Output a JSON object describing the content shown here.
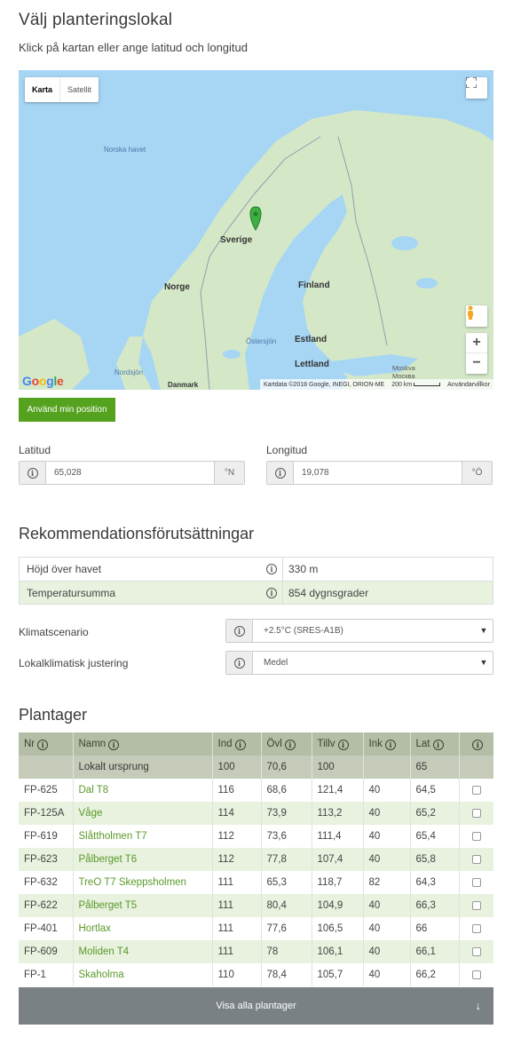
{
  "page": {
    "title": "Välj planteringslokal",
    "subtitle": "Klick på kartan eller ange latitud och longitud"
  },
  "map": {
    "type_buttons": [
      "Karta",
      "Satellit"
    ],
    "labels": {
      "sea_norway": "Norska havet",
      "sweden": "Sverige",
      "norway": "Norge",
      "finland": "Finland",
      "estonia": "Estland",
      "latvia": "Lettland",
      "baltic": "Östersjön",
      "north_sea": "Nordsjön",
      "denmark": "Danmark",
      "moscow": "Moskva\nМосква"
    },
    "google_logo": "Google",
    "attribution": "Kartdata ©2018 Google, INEGI, ORION-ME",
    "scale": "200 km",
    "terms": "Användarvillkor",
    "zoom_in": "+",
    "zoom_out": "−",
    "colors": {
      "water": "#a7d5f4",
      "land": "#cfe6c4",
      "marker": "#3cb043"
    }
  },
  "use_position_button": "Använd min position",
  "latitude": {
    "label": "Latitud",
    "value": "65,028",
    "unit": "°N"
  },
  "longitude": {
    "label": "Longitud",
    "value": "19,078",
    "unit": "°Ö"
  },
  "recommendations": {
    "title": "Rekommendationsförutsättningar",
    "rows": [
      {
        "label": "Höjd över havet",
        "value": "330 m"
      },
      {
        "label": "Temperatursumma",
        "value": "854 dygnsgrader"
      }
    ]
  },
  "climate_scenario": {
    "label": "Klimatscenario",
    "value": "+2.5°C (SRES-A1B)"
  },
  "local_adjustment": {
    "label": "Lokalklimatisk justering",
    "value": "Medel"
  },
  "plantations": {
    "title": "Plantager",
    "columns": [
      "Nr",
      "Namn",
      "Ind",
      "Övl",
      "Tillv",
      "Ink",
      "Lat"
    ],
    "local_origin": {
      "nr": "",
      "name": "Lokalt ursprung",
      "ind": "100",
      "ovl": "70,6",
      "tillv": "100",
      "ink": "",
      "lat": "65"
    },
    "rows": [
      {
        "nr": "FP-625",
        "name": "Dal T8",
        "ind": "116",
        "ovl": "68,6",
        "tillv": "121,4",
        "ink": "40",
        "lat": "64,5"
      },
      {
        "nr": "FP-125A",
        "name": "Våge",
        "ind": "114",
        "ovl": "73,9",
        "tillv": "113,2",
        "ink": "40",
        "lat": "65,2"
      },
      {
        "nr": "FP-619",
        "name": "Slåttholmen T7",
        "ind": "112",
        "ovl": "73,6",
        "tillv": "111,4",
        "ink": "40",
        "lat": "65,4"
      },
      {
        "nr": "FP-623",
        "name": "Pålberget T6",
        "ind": "112",
        "ovl": "77,8",
        "tillv": "107,4",
        "ink": "40",
        "lat": "65,8"
      },
      {
        "nr": "FP-632",
        "name": "TreO T7 Skeppsholmen",
        "ind": "111",
        "ovl": "65,3",
        "tillv": "118,7",
        "ink": "82",
        "lat": "64,3"
      },
      {
        "nr": "FP-622",
        "name": "Pålberget T5",
        "ind": "111",
        "ovl": "80,4",
        "tillv": "104,9",
        "ink": "40",
        "lat": "66,3"
      },
      {
        "nr": "FP-401",
        "name": "Hortlax",
        "ind": "111",
        "ovl": "77,6",
        "tillv": "106,5",
        "ink": "40",
        "lat": "66"
      },
      {
        "nr": "FP-609",
        "name": "Moliden T4",
        "ind": "111",
        "ovl": "78",
        "tillv": "106,1",
        "ink": "40",
        "lat": "66,1"
      },
      {
        "nr": "FP-1",
        "name": "Skaholma",
        "ind": "110",
        "ovl": "78,4",
        "tillv": "105,7",
        "ink": "40",
        "lat": "66,2"
      }
    ],
    "show_all": "Visa alla plantager"
  }
}
